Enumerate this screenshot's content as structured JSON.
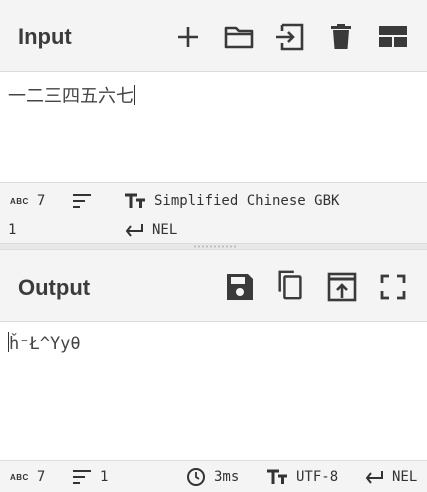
{
  "input": {
    "title": "Input",
    "text": "一二三四五六七",
    "status": {
      "length_label": "ABC",
      "length": "7",
      "lines": "1",
      "encoding": "Simplified Chinese GBK",
      "eol": "NEL"
    }
  },
  "output": {
    "title": "Output",
    "text": "ȟ⁻Ł^Yyθ",
    "status": {
      "length_label": "ABC",
      "length": "7",
      "lines": "1",
      "time": "3ms",
      "encoding": "UTF-8",
      "eol": "NEL"
    }
  },
  "icons": {
    "input_toolbar": [
      "add-icon",
      "folder-open-icon",
      "file-import-icon",
      "trash-icon",
      "layout-icon"
    ],
    "output_toolbar": [
      "save-icon",
      "copy-icon",
      "open-in-new-icon",
      "fullscreen-icon"
    ]
  }
}
